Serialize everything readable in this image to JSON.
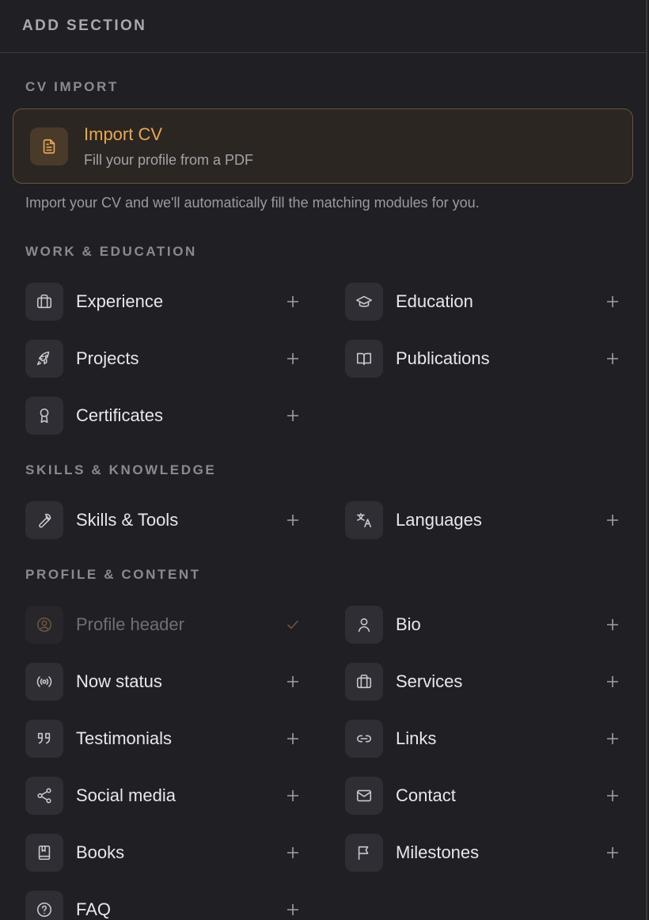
{
  "header": {
    "title": "ADD SECTION"
  },
  "cv_import": {
    "title": "CV IMPORT",
    "card_title": "Import CV",
    "card_subtitle": "Fill your profile from a PDF",
    "help": "Import your CV and we'll automatically fill the matching modules for you."
  },
  "work_education": {
    "title": "WORK & EDUCATION",
    "items": [
      {
        "label": "Experience",
        "icon": "briefcase-icon"
      },
      {
        "label": "Education",
        "icon": "graduation-cap-icon"
      },
      {
        "label": "Projects",
        "icon": "rocket-icon"
      },
      {
        "label": "Publications",
        "icon": "book-open-icon"
      },
      {
        "label": "Certificates",
        "icon": "award-icon"
      }
    ]
  },
  "skills_knowledge": {
    "title": "SKILLS & KNOWLEDGE",
    "items": [
      {
        "label": "Skills & Tools",
        "icon": "wrench-icon"
      },
      {
        "label": "Languages",
        "icon": "translate-icon"
      }
    ]
  },
  "profile_content": {
    "title": "PROFILE & CONTENT",
    "items": [
      {
        "label": "Profile header",
        "icon": "user-circle-icon",
        "status": "added"
      },
      {
        "label": "Bio",
        "icon": "user-icon"
      },
      {
        "label": "Now status",
        "icon": "broadcast-icon"
      },
      {
        "label": "Services",
        "icon": "briefcase-icon"
      },
      {
        "label": "Testimonials",
        "icon": "quote-icon"
      },
      {
        "label": "Links",
        "icon": "link-icon"
      },
      {
        "label": "Social media",
        "icon": "share-icon"
      },
      {
        "label": "Contact",
        "icon": "mail-icon"
      },
      {
        "label": "Books",
        "icon": "book-icon"
      },
      {
        "label": "Milestones",
        "icon": "flag-icon"
      },
      {
        "label": "FAQ",
        "icon": "help-circle-icon"
      }
    ]
  },
  "colors": {
    "accent": "#e8a656",
    "background": "#1f1f24",
    "tile": "#2e2e34"
  }
}
